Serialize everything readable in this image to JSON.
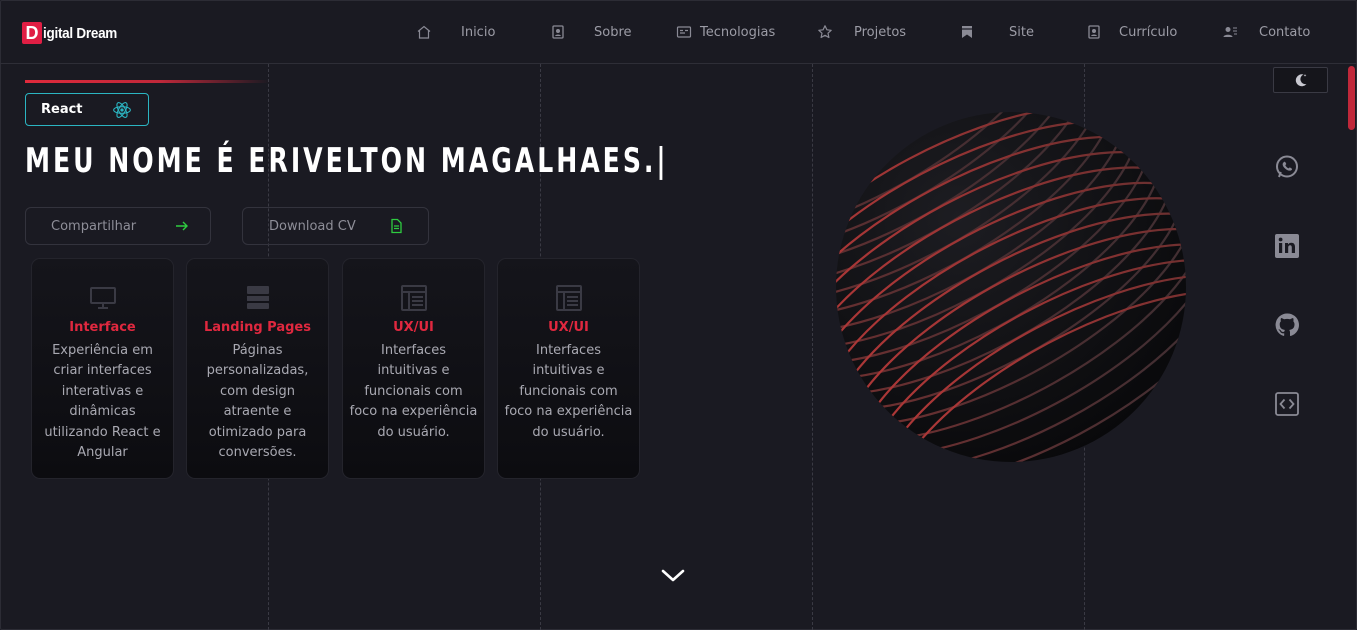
{
  "logo": {
    "letter": "D",
    "text": "igital Dream"
  },
  "nav": [
    {
      "label": "Inicio",
      "icon": "home-icon"
    },
    {
      "label": "Sobre",
      "icon": "contact-card-icon"
    },
    {
      "label": "Tecnologias",
      "icon": "terminal-icon"
    },
    {
      "label": "Projetos",
      "icon": "star-icon"
    },
    {
      "label": "Site",
      "icon": "bookmark-icon"
    },
    {
      "label": "Currículo",
      "icon": "resume-icon"
    },
    {
      "label": "Contato",
      "icon": "contacts-icon"
    }
  ],
  "hero": {
    "badge": "React",
    "headline": "MEU NOME É ERIVELTON MAGALHAES.|",
    "share_label": "Compartilhar",
    "download_label": "Download CV"
  },
  "cards": [
    {
      "title": "Interface",
      "icon": "monitor-icon",
      "desc": "Experiência em criar interfaces interativas e dinâmicas utilizando React e Angular"
    },
    {
      "title": "Landing Pages",
      "icon": "layers-icon",
      "desc": "Páginas personalizadas, com design atraente e otimizado para conversões."
    },
    {
      "title": "UX/UI",
      "icon": "layout-icon",
      "desc": "Interfaces intuitivas e funcionais com foco na experiência do usuário."
    },
    {
      "title": "UX/UI",
      "icon": "layout-icon",
      "desc": "Interfaces intuitivas e funcionais com foco na experiência do usuário."
    }
  ],
  "social": [
    "whatsapp-icon",
    "linkedin-icon",
    "github-icon",
    "code-icon"
  ],
  "colors": {
    "accent": "#e0283f",
    "badge_border": "#2bb5c2",
    "background": "#1a1a22"
  }
}
